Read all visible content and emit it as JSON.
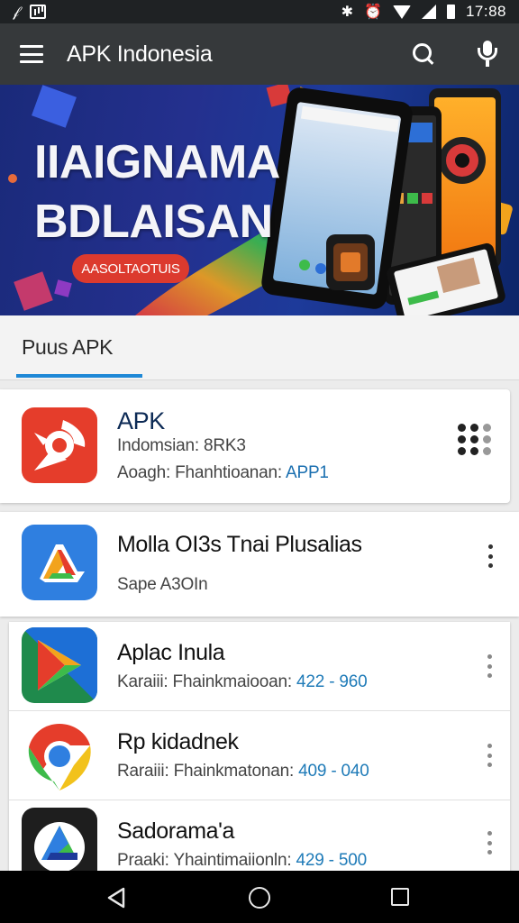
{
  "status_bar": {
    "time": "17:88",
    "left_icons": [
      "headset-icon",
      "image-icon"
    ],
    "right_icons": [
      "bluetooth-icon",
      "alarm-icon",
      "wifi-icon",
      "signal-icon",
      "battery-icon"
    ]
  },
  "app_bar": {
    "title": "APK Indonesia",
    "background": "#36393b",
    "icons": [
      "menu-icon",
      "search-icon",
      "mic-icon"
    ]
  },
  "banner": {
    "title_line1": "IIAIGNAMA",
    "title_line2": "BDLAISAN",
    "button_label": "AASOLTAOTUIS",
    "accent": "#dc3a2e"
  },
  "tab": {
    "label": "Puus APK",
    "accent": "#1e88d6"
  },
  "featured_app": {
    "name": "APK",
    "line1": "Indomsian: 8RK3",
    "line2_prefix": "Aoagh: Fhanhtioanan: ",
    "line2_accent": "APP1",
    "icon": "bomb-icon",
    "icon_color": "#e53d2b",
    "action_icon": "grid-icon"
  },
  "second_app": {
    "name": "Molla OI3s Tnai Plusalias",
    "line1": "Sape A3OIn",
    "icon": "google-drive-icon",
    "icon_color": "#2f7fe0"
  },
  "apps": [
    {
      "name": "Aplac Inula",
      "meta_prefix": "Karaiii: Fhainkmaiooan: ",
      "meta_value": "422 - 960",
      "icon": "google-play-icon"
    },
    {
      "name": "Rp kidadnek",
      "meta_prefix": "Raraiii: Fhainkmatonan: ",
      "meta_value": "409 - 040",
      "icon": "chrome-icon"
    },
    {
      "name": "Sadorama'a",
      "meta_prefix": "Praaki: Yhaintimaiionln: ",
      "meta_value": "429 - 500",
      "icon": "drive-triangle-icon"
    }
  ],
  "nav_bar": {
    "icons": [
      "back-icon",
      "home-icon",
      "recents-icon"
    ]
  }
}
